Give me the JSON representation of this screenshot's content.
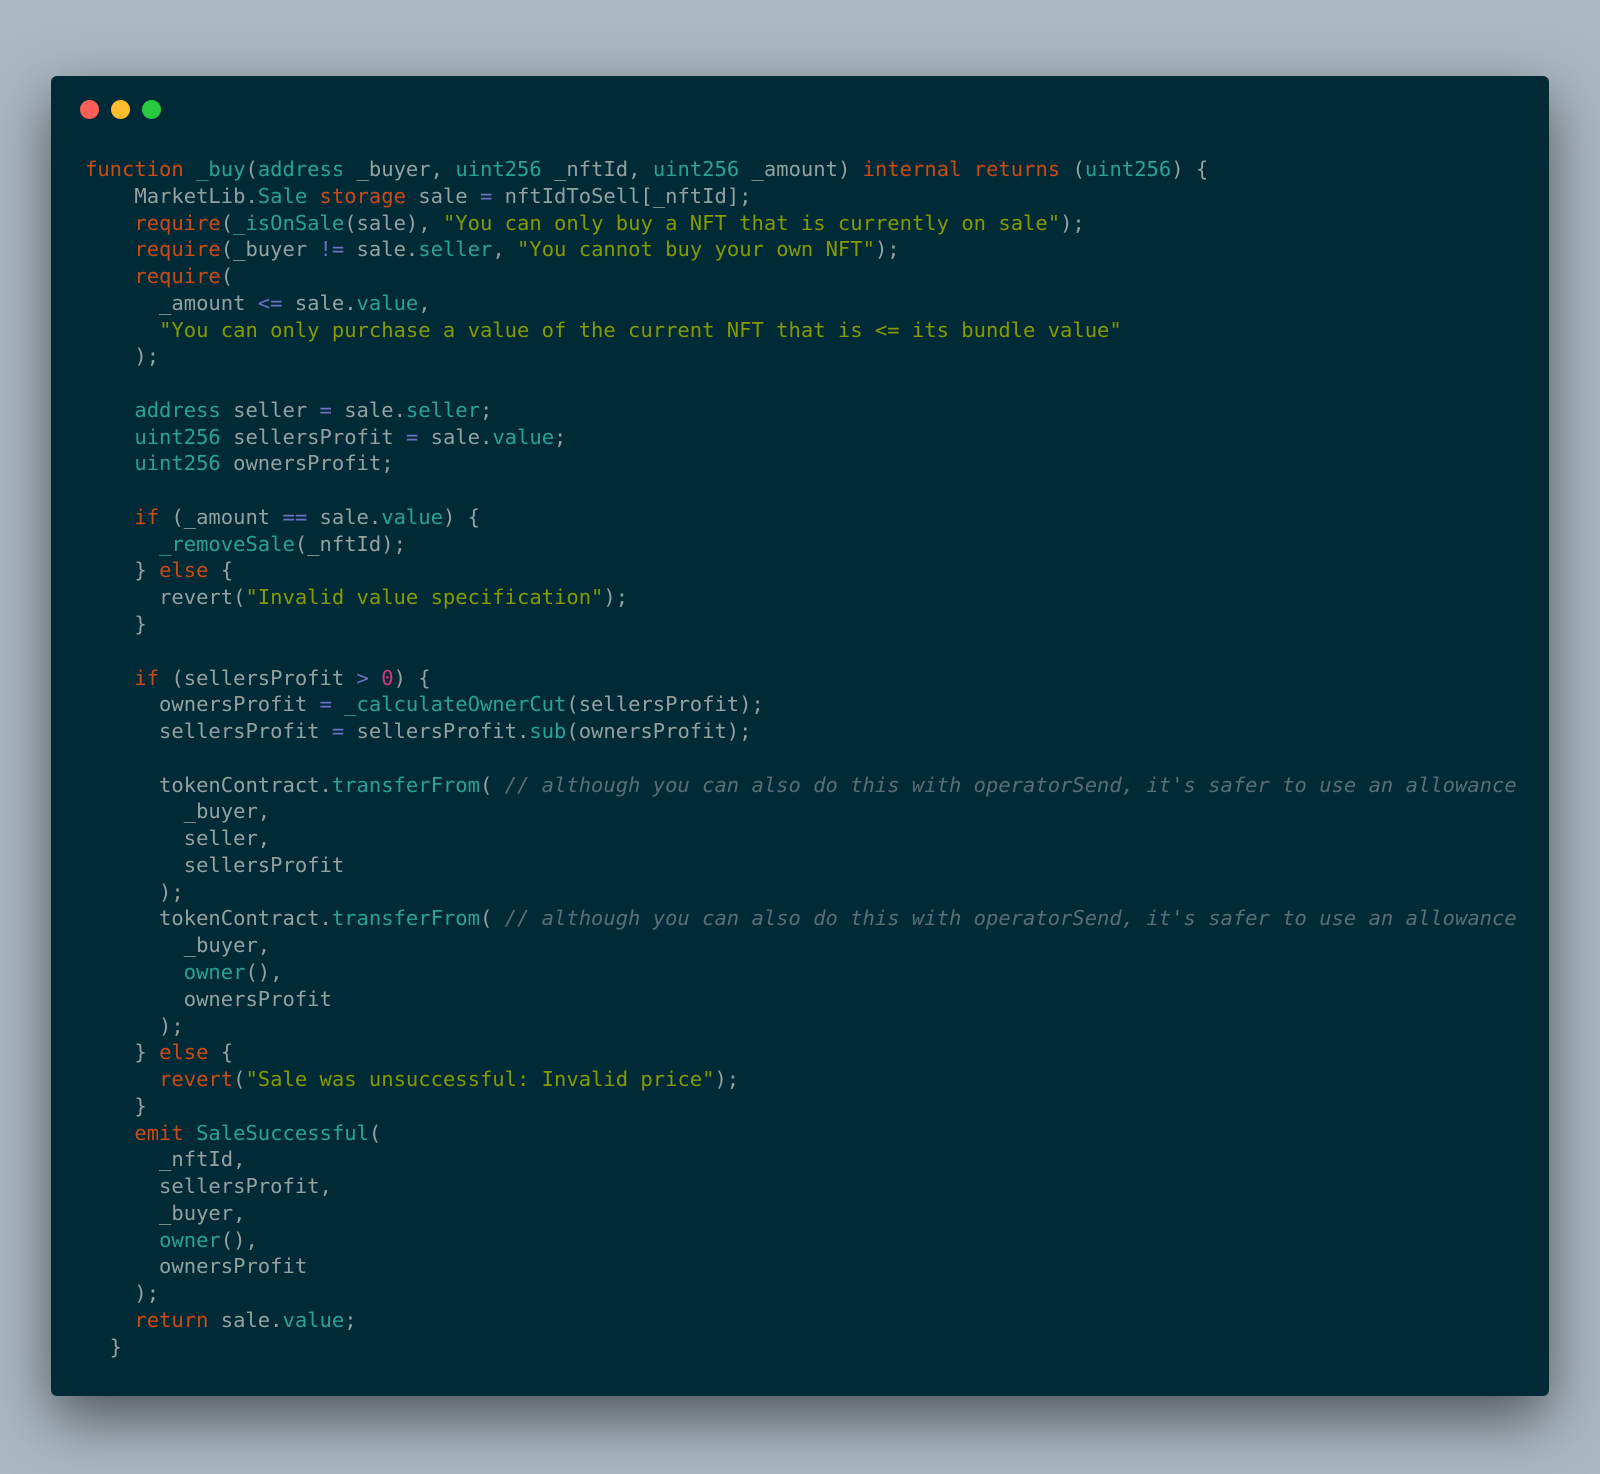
{
  "window": {
    "controls": [
      {
        "name": "close-button",
        "color": "#ff5f56"
      },
      {
        "name": "minimize-button",
        "color": "#ffbd2e"
      },
      {
        "name": "maximize-button",
        "color": "#27c93f"
      }
    ]
  },
  "colors": {
    "background": "#abb8c3",
    "editor": "#002b36",
    "plain": "#93a1a1",
    "keyword": "#cb4b16",
    "type": "#2aa198",
    "string": "#859900",
    "operator": "#6c71c4",
    "number": "#d33682",
    "comment": "#586e75"
  },
  "code_lines": [
    [
      [
        "k",
        "function"
      ],
      [
        "p",
        " "
      ],
      [
        "t",
        "_buy"
      ],
      [
        "p",
        "("
      ],
      [
        "t",
        "address"
      ],
      [
        "p",
        " _buyer, "
      ],
      [
        "t",
        "uint256"
      ],
      [
        "p",
        " _nftId, "
      ],
      [
        "t",
        "uint256"
      ],
      [
        "p",
        " _amount) "
      ],
      [
        "k",
        "internal"
      ],
      [
        "p",
        " "
      ],
      [
        "k",
        "returns"
      ],
      [
        "p",
        " ("
      ],
      [
        "t",
        "uint256"
      ],
      [
        "p",
        ") {"
      ]
    ],
    [
      [
        "p",
        "    MarketLib."
      ],
      [
        "t",
        "Sale"
      ],
      [
        "p",
        " "
      ],
      [
        "k",
        "storage"
      ],
      [
        "p",
        " sale "
      ],
      [
        "o",
        "="
      ],
      [
        "p",
        " nftIdToSell[_nftId];"
      ]
    ],
    [
      [
        "p",
        "    "
      ],
      [
        "k",
        "require"
      ],
      [
        "p",
        "("
      ],
      [
        "t",
        "_isOnSale"
      ],
      [
        "p",
        "(sale), "
      ],
      [
        "s",
        "\"You can only buy a NFT that is currently on sale\""
      ],
      [
        "p",
        ");"
      ]
    ],
    [
      [
        "p",
        "    "
      ],
      [
        "k",
        "require"
      ],
      [
        "p",
        "(_buyer "
      ],
      [
        "o",
        "!="
      ],
      [
        "p",
        " sale."
      ],
      [
        "t",
        "seller"
      ],
      [
        "p",
        ", "
      ],
      [
        "s",
        "\"You cannot buy your own NFT\""
      ],
      [
        "p",
        ");"
      ]
    ],
    [
      [
        "p",
        "    "
      ],
      [
        "k",
        "require"
      ],
      [
        "p",
        "("
      ]
    ],
    [
      [
        "p",
        "      _amount "
      ],
      [
        "o",
        "<="
      ],
      [
        "p",
        " sale."
      ],
      [
        "t",
        "value"
      ],
      [
        "p",
        ","
      ]
    ],
    [
      [
        "p",
        "      "
      ],
      [
        "s",
        "\"You can only purchase a value of the current NFT that is <= its bundle value\""
      ]
    ],
    [
      [
        "p",
        "    );"
      ]
    ],
    [],
    [
      [
        "p",
        "    "
      ],
      [
        "t",
        "address"
      ],
      [
        "p",
        " seller "
      ],
      [
        "o",
        "="
      ],
      [
        "p",
        " sale."
      ],
      [
        "t",
        "seller"
      ],
      [
        "p",
        ";"
      ]
    ],
    [
      [
        "p",
        "    "
      ],
      [
        "t",
        "uint256"
      ],
      [
        "p",
        " sellersProfit "
      ],
      [
        "o",
        "="
      ],
      [
        "p",
        " sale."
      ],
      [
        "t",
        "value"
      ],
      [
        "p",
        ";"
      ]
    ],
    [
      [
        "p",
        "    "
      ],
      [
        "t",
        "uint256"
      ],
      [
        "p",
        " ownersProfit;"
      ]
    ],
    [],
    [
      [
        "p",
        "    "
      ],
      [
        "k",
        "if"
      ],
      [
        "p",
        " (_amount "
      ],
      [
        "o",
        "=="
      ],
      [
        "p",
        " sale."
      ],
      [
        "t",
        "value"
      ],
      [
        "p",
        ") {"
      ]
    ],
    [
      [
        "p",
        "      "
      ],
      [
        "t",
        "_removeSale"
      ],
      [
        "p",
        "(_nftId);"
      ]
    ],
    [
      [
        "p",
        "    } "
      ],
      [
        "k",
        "else"
      ],
      [
        "p",
        " {"
      ]
    ],
    [
      [
        "p",
        "      revert("
      ],
      [
        "s",
        "\"Invalid value specification\""
      ],
      [
        "p",
        ");"
      ]
    ],
    [
      [
        "p",
        "    }"
      ]
    ],
    [],
    [
      [
        "p",
        "    "
      ],
      [
        "k",
        "if"
      ],
      [
        "p",
        " (sellersProfit "
      ],
      [
        "o",
        ">"
      ],
      [
        "p",
        " "
      ],
      [
        "n",
        "0"
      ],
      [
        "p",
        ") {"
      ]
    ],
    [
      [
        "p",
        "      ownersProfit "
      ],
      [
        "o",
        "="
      ],
      [
        "p",
        " "
      ],
      [
        "t",
        "_calculateOwnerCut"
      ],
      [
        "p",
        "(sellersProfit);"
      ]
    ],
    [
      [
        "p",
        "      sellersProfit "
      ],
      [
        "o",
        "="
      ],
      [
        "p",
        " sellersProfit."
      ],
      [
        "t",
        "sub"
      ],
      [
        "p",
        "(ownersProfit);"
      ]
    ],
    [],
    [
      [
        "p",
        "      tokenContract."
      ],
      [
        "t",
        "transferFrom"
      ],
      [
        "p",
        "( "
      ],
      [
        "c",
        "// although you can also do this with operatorSend, it's safer to use an allowance"
      ]
    ],
    [
      [
        "p",
        "        _buyer,"
      ]
    ],
    [
      [
        "p",
        "        seller,"
      ]
    ],
    [
      [
        "p",
        "        sellersProfit"
      ]
    ],
    [
      [
        "p",
        "      );"
      ]
    ],
    [
      [
        "p",
        "      tokenContract."
      ],
      [
        "t",
        "transferFrom"
      ],
      [
        "p",
        "( "
      ],
      [
        "c",
        "// although you can also do this with operatorSend, it's safer to use an allowance"
      ]
    ],
    [
      [
        "p",
        "        _buyer,"
      ]
    ],
    [
      [
        "p",
        "        "
      ],
      [
        "t",
        "owner"
      ],
      [
        "p",
        "(),"
      ]
    ],
    [
      [
        "p",
        "        ownersProfit"
      ]
    ],
    [
      [
        "p",
        "      );"
      ]
    ],
    [
      [
        "p",
        "    } "
      ],
      [
        "k",
        "else"
      ],
      [
        "p",
        " {"
      ]
    ],
    [
      [
        "p",
        "      "
      ],
      [
        "k",
        "revert"
      ],
      [
        "p",
        "("
      ],
      [
        "s",
        "\"Sale was unsuccessful: Invalid price\""
      ],
      [
        "p",
        ");"
      ]
    ],
    [
      [
        "p",
        "    }"
      ]
    ],
    [
      [
        "p",
        "    "
      ],
      [
        "k",
        "emit"
      ],
      [
        "p",
        " "
      ],
      [
        "t",
        "SaleSuccessful"
      ],
      [
        "p",
        "("
      ]
    ],
    [
      [
        "p",
        "      _nftId,"
      ]
    ],
    [
      [
        "p",
        "      sellersProfit,"
      ]
    ],
    [
      [
        "p",
        "      _buyer,"
      ]
    ],
    [
      [
        "p",
        "      "
      ],
      [
        "t",
        "owner"
      ],
      [
        "p",
        "(),"
      ]
    ],
    [
      [
        "p",
        "      ownersProfit"
      ]
    ],
    [
      [
        "p",
        "    );"
      ]
    ],
    [
      [
        "p",
        "    "
      ],
      [
        "k",
        "return"
      ],
      [
        "p",
        " sale."
      ],
      [
        "t",
        "value"
      ],
      [
        "p",
        ";"
      ]
    ],
    [
      [
        "p",
        "  }"
      ]
    ]
  ]
}
